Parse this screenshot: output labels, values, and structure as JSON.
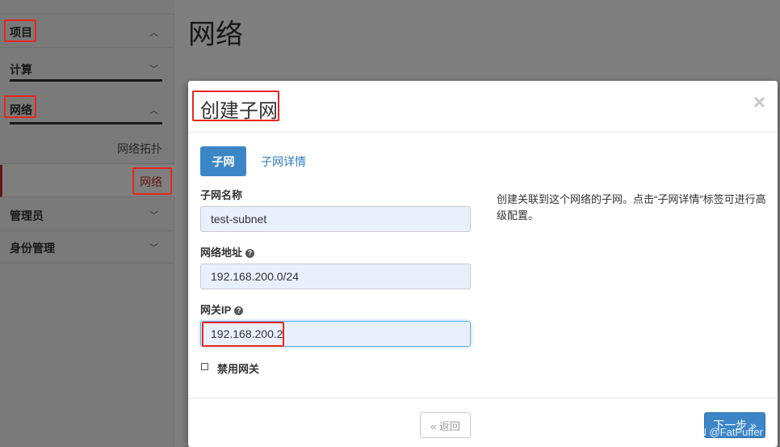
{
  "sidebar": {
    "groups": [
      {
        "label": "项目"
      },
      {
        "label": "计算"
      },
      {
        "label": "网络"
      },
      {
        "label": "管理员"
      },
      {
        "label": "身份管理"
      }
    ],
    "network_items": [
      {
        "label": "网络拓扑"
      },
      {
        "label": "网络"
      }
    ]
  },
  "page": {
    "title": "网络"
  },
  "modal": {
    "title": "创建子网",
    "close_symbol": "×",
    "tabs": [
      {
        "label": "子网",
        "active": true
      },
      {
        "label": "子网详情",
        "active": false
      }
    ],
    "fields": {
      "subnet_name": {
        "label": "子网名称",
        "value": "test-subnet"
      },
      "network_address": {
        "label": "网络地址",
        "value": "192.168.200.0/24"
      },
      "gateway_ip": {
        "label": "网关IP",
        "value": "192.168.200.2"
      }
    },
    "help_glyph": "?",
    "disable_gateway": {
      "label": "禁用网关",
      "checked": false
    },
    "help_text": "创建关联到这个网络的子网。点击“子网详情”标签可进行高级配置。",
    "footer": {
      "back_label": "« 返回",
      "next_label": "下一步 »"
    }
  },
  "watermark": "CSDN @FatPuffer",
  "colors": {
    "primary": "#3c86c8",
    "highlight": "#e8271d",
    "link": "#2a79c2"
  }
}
